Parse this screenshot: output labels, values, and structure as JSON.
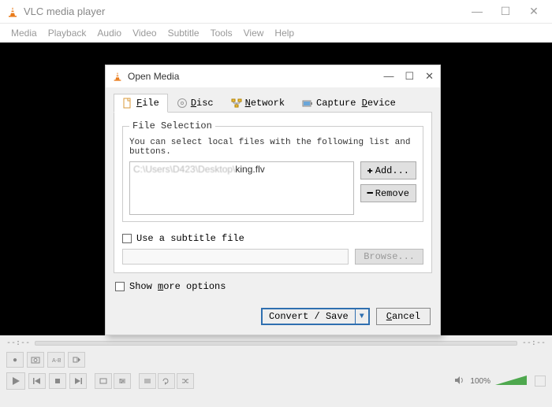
{
  "app": {
    "title": "VLC media player"
  },
  "menubar": [
    "Media",
    "Playback",
    "Audio",
    "Video",
    "Subtitle",
    "Tools",
    "View",
    "Help"
  ],
  "dialog": {
    "title": "Open Media",
    "tabs": {
      "file": "File",
      "disc": "Disc",
      "network": "Network",
      "capture": "Capture Device"
    },
    "file_selection": {
      "legend": "File Selection",
      "desc": "You can select local files with the following list and buttons.",
      "file_path_blurred": "C:\\Users\\D423\\Desktop\\",
      "file_name": "king.flv",
      "add_label": "Add...",
      "remove_label": "Remove"
    },
    "subtitle": {
      "checkbox_label": "Use a subtitle file",
      "browse_label": "Browse..."
    },
    "more_options": "Show more options",
    "actions": {
      "convert": "Convert / Save",
      "cancel": "Cancel"
    }
  },
  "controls": {
    "time_left": "--:--",
    "time_right": "--:--",
    "volume_pct": "100%"
  }
}
